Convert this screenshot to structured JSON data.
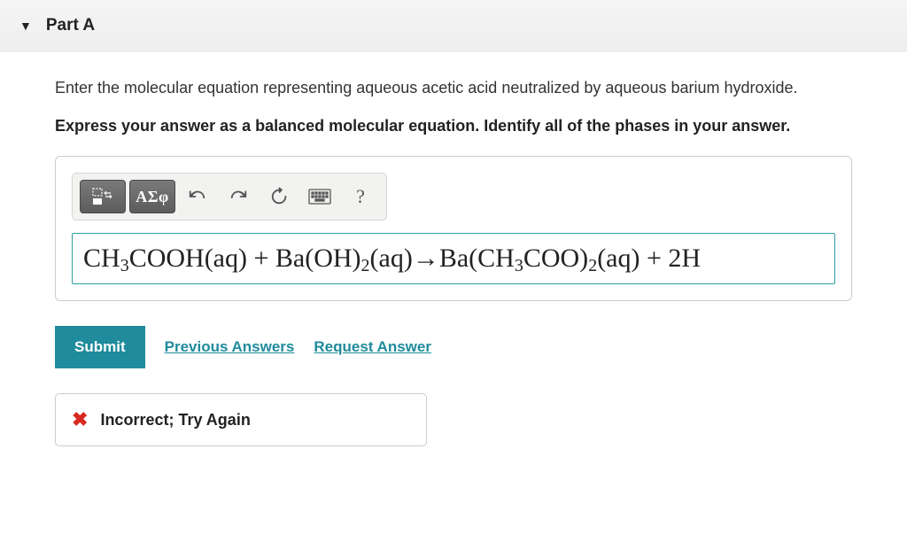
{
  "part": {
    "title": "Part A"
  },
  "question": "Enter the molecular equation representing aqueous acetic acid neutralized by aqueous barium hydroxide.",
  "instruction": "Express your answer as a balanced molecular equation. Identify all of the phases in your answer.",
  "toolbar": {
    "greek_button": "ΑΣφ",
    "help": "?"
  },
  "answer": {
    "equation_html": "CH<sub>3</sub> COOH(aq) + Ba(OH)<sub>2</sub> (aq)→Ba(CH<sub>3</sub> COO)<sub>2</sub> (aq) + 2H"
  },
  "actions": {
    "submit": "Submit",
    "previous": "Previous Answers",
    "request": "Request Answer"
  },
  "feedback": {
    "text": "Incorrect; Try Again"
  }
}
